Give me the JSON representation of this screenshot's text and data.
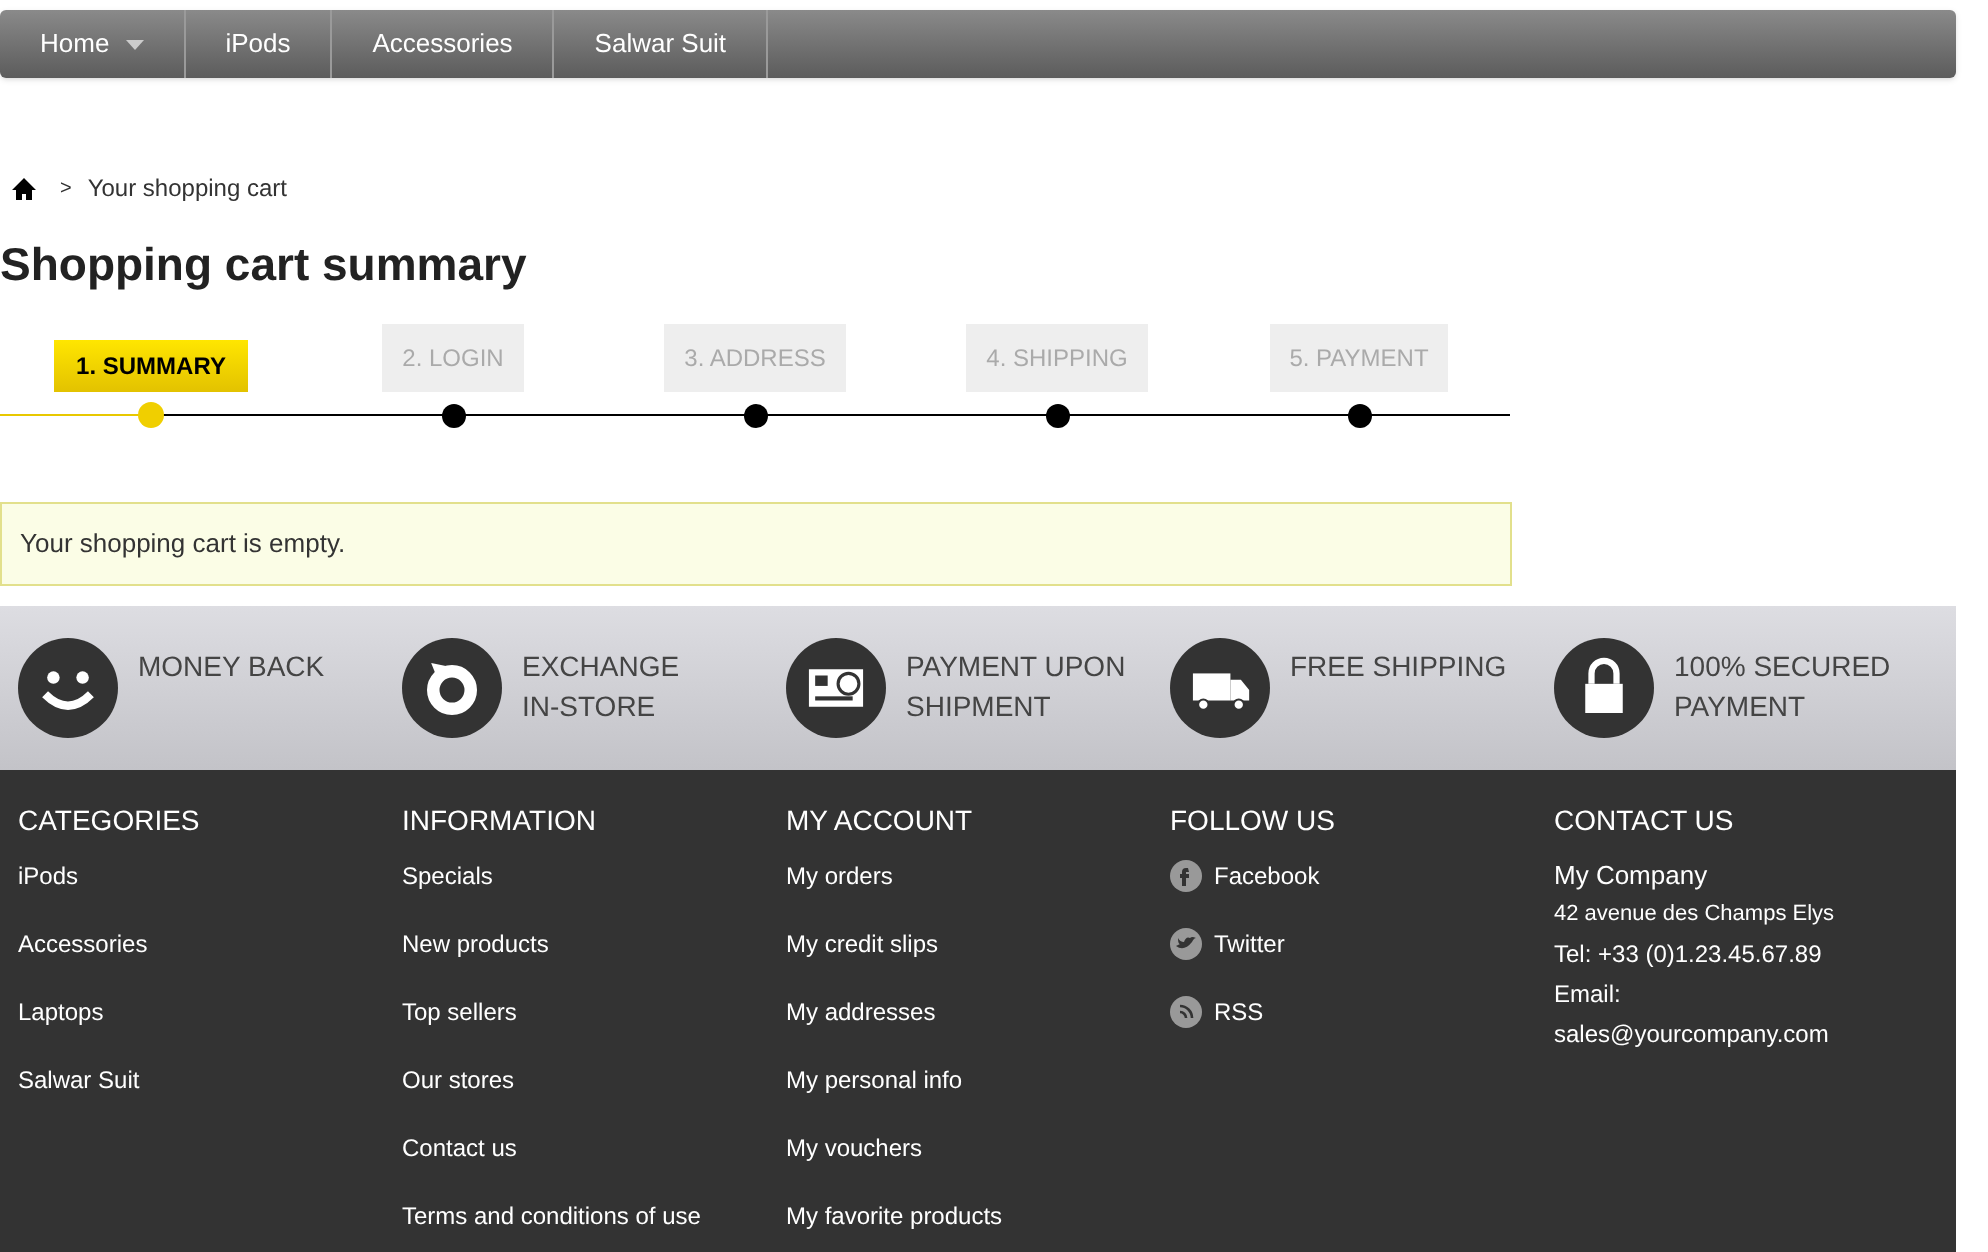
{
  "nav": [
    {
      "label": "Home",
      "has_dropdown": true
    },
    {
      "label": "iPods",
      "has_dropdown": false
    },
    {
      "label": "Accessories",
      "has_dropdown": false
    },
    {
      "label": "Salwar Suit",
      "has_dropdown": false
    }
  ],
  "breadcrumb": {
    "separator": ">",
    "current": "Your shopping cart"
  },
  "title": "Shopping cart summary",
  "steps": [
    {
      "label": "1. SUMMARY",
      "selected": true
    },
    {
      "label": "2. LOGIN",
      "selected": false
    },
    {
      "label": "3. ADDRESS",
      "selected": false
    },
    {
      "label": "4. SHIPPING",
      "selected": false
    },
    {
      "label": "5. PAYMENT",
      "selected": false
    }
  ],
  "alert": "Your shopping cart is empty.",
  "features": [
    {
      "kind": "smile",
      "lines": [
        "MONEY BACK"
      ]
    },
    {
      "kind": "exchange",
      "lines": [
        "EXCHANGE",
        "IN-STORE"
      ]
    },
    {
      "kind": "card",
      "lines": [
        "PAYMENT UPON",
        "SHIPMENT"
      ]
    },
    {
      "kind": "truck",
      "lines": [
        "FREE SHIPPING"
      ]
    },
    {
      "kind": "lock",
      "lines": [
        "100% SECURED",
        "PAYMENT"
      ]
    }
  ],
  "footer": {
    "columns": [
      {
        "heading": "CATEGORIES",
        "links": [
          {
            "label": "iPods"
          },
          {
            "label": "Accessories"
          },
          {
            "label": "Laptops"
          },
          {
            "label": "Salwar Suit"
          }
        ]
      },
      {
        "heading": "INFORMATION",
        "links": [
          {
            "label": "Specials"
          },
          {
            "label": "New products"
          },
          {
            "label": "Top sellers"
          },
          {
            "label": "Our stores"
          },
          {
            "label": "Contact us"
          },
          {
            "label": "Terms and conditions of use"
          }
        ]
      },
      {
        "heading": "MY ACCOUNT",
        "links": [
          {
            "label": "My orders"
          },
          {
            "label": "My credit slips"
          },
          {
            "label": "My addresses"
          },
          {
            "label": "My personal info"
          },
          {
            "label": "My vouchers"
          },
          {
            "label": "My favorite products"
          }
        ]
      },
      {
        "heading": "FOLLOW US",
        "links": [
          {
            "label": "Facebook",
            "kind": "facebook"
          },
          {
            "label": "Twitter",
            "kind": "twitter"
          },
          {
            "label": "RSS",
            "kind": "rss"
          }
        ]
      }
    ],
    "contact": {
      "heading": "CONTACT US",
      "company": "My Company",
      "address": "42 avenue des Champs Elys",
      "phone": "Tel: +33 (0)1.23.45.67.89",
      "email_label": "Email:",
      "email": "sales@yourcompany.com"
    }
  }
}
